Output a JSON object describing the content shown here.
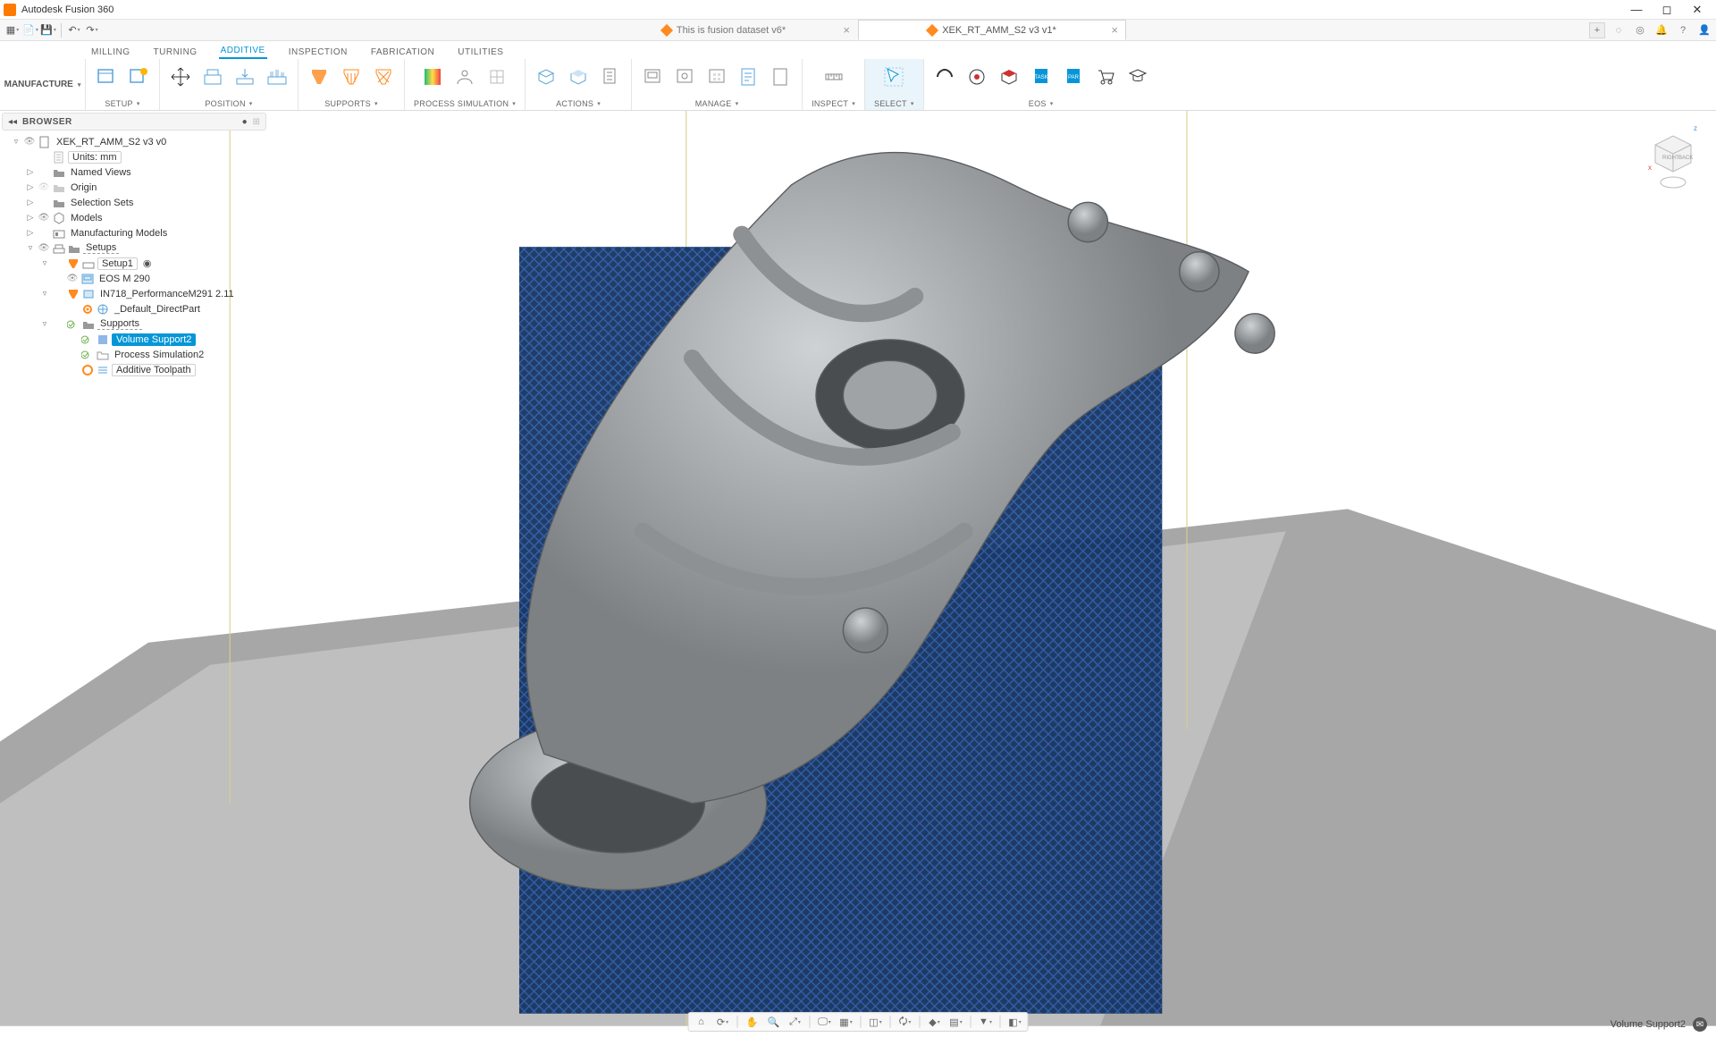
{
  "app": {
    "title": "Autodesk Fusion 360"
  },
  "qat": {
    "items": [
      "grid",
      "file",
      "save",
      "sep",
      "undo",
      "redo"
    ]
  },
  "doc_tabs": [
    {
      "label": "This is fusion dataset v6*",
      "active": false
    },
    {
      "label": "XEK_RT_AMM_S2 v3 v1*",
      "active": true
    }
  ],
  "topright_icons": [
    "plus",
    "globe",
    "target",
    "bell",
    "help",
    "avatar"
  ],
  "ribbon": {
    "workspace": "MANUFACTURE",
    "tabs": [
      "MILLING",
      "TURNING",
      "ADDITIVE",
      "INSPECTION",
      "FABRICATION",
      "UTILITIES"
    ],
    "active_tab": "ADDITIVE",
    "panels": [
      {
        "label": "SETUP",
        "drop": true,
        "icons": [
          "setup",
          "setup2"
        ]
      },
      {
        "label": "POSITION",
        "drop": true,
        "icons": [
          "move",
          "pos1",
          "pos2",
          "pos3"
        ]
      },
      {
        "label": "SUPPORTS",
        "drop": true,
        "icons": [
          "sup1",
          "sup2",
          "sup3"
        ]
      },
      {
        "label": "PROCESS SIMULATION",
        "drop": true,
        "icons": [
          "psim",
          "psim2",
          "psim3"
        ]
      },
      {
        "label": "ACTIONS",
        "drop": true,
        "icons": [
          "act1",
          "act2",
          "act3"
        ]
      },
      {
        "label": "MANAGE",
        "drop": true,
        "icons": [
          "man1",
          "man2",
          "man3",
          "man4",
          "man5"
        ]
      },
      {
        "label": "INSPECT",
        "drop": true,
        "icons": [
          "inspect"
        ]
      },
      {
        "label": "SELECT",
        "drop": true,
        "icons": [
          "select"
        ],
        "highlight": true
      },
      {
        "label": "EOS",
        "drop": true,
        "icons": [
          "eos1",
          "eos2",
          "eos3",
          "eos4",
          "eos5",
          "eos6",
          "eos7"
        ]
      }
    ]
  },
  "browser": {
    "title": "BROWSER",
    "nodes": [
      {
        "depth": 0,
        "tw": "▿",
        "eye": true,
        "icon": "doc",
        "label": "XEK_RT_AMM_S2 v3 v0"
      },
      {
        "depth": 1,
        "tw": "",
        "eye": false,
        "icon": "page",
        "label": "Units: mm",
        "boxed": true
      },
      {
        "depth": 1,
        "tw": "▷",
        "eye": false,
        "icon": "folder",
        "label": "Named Views"
      },
      {
        "depth": 1,
        "tw": "▷",
        "eye": "dim",
        "icon": "folder-dim",
        "label": "Origin"
      },
      {
        "depth": 1,
        "tw": "▷",
        "eye": false,
        "icon": "folder",
        "label": "Selection Sets"
      },
      {
        "depth": 1,
        "tw": "▷",
        "eye": true,
        "icon": "models",
        "label": "Models"
      },
      {
        "depth": 1,
        "tw": "▷",
        "eye": false,
        "icon": "mfg",
        "label": "Manufacturing Models"
      },
      {
        "depth": 1,
        "tw": "▿",
        "eye": true,
        "icon": "setups",
        "label": "Setups",
        "dotted": true
      },
      {
        "depth": 2,
        "tw": "▿",
        "eye": false,
        "icon": "setup-orange",
        "label": "Setup1",
        "boxed": true,
        "radio": true
      },
      {
        "depth": 3,
        "tw": "",
        "eye": true,
        "icon": "machine",
        "label": "EOS M 290"
      },
      {
        "depth": 2,
        "tw": "▿",
        "eye": false,
        "icon": "setup-orange",
        "label": "IN718_PerformanceM291 2.11"
      },
      {
        "depth": 3,
        "tw": "",
        "eye": false,
        "icon": "gear-orange",
        "label": "_Default_DirectPart"
      },
      {
        "depth": 2,
        "tw": "▿",
        "eye": false,
        "icon": "ok-folder",
        "label": "Supports",
        "dotted": true
      },
      {
        "depth": 3,
        "tw": "",
        "eye": false,
        "icon": "ok-vol",
        "label": "Volume Support2",
        "selected": true
      },
      {
        "depth": 3,
        "tw": "",
        "eye": false,
        "icon": "ok-folder2",
        "label": "Process Simulation2"
      },
      {
        "depth": 3,
        "tw": "",
        "eye": false,
        "icon": "add-orange",
        "label": "Additive Toolpath",
        "boxed": true
      }
    ]
  },
  "navbar": [
    "home",
    "orbit",
    "sep",
    "pan",
    "zoom",
    "zoom2",
    "sep",
    "display",
    "grid",
    "sep",
    "section",
    "sep",
    "sync",
    "sep",
    "eye",
    "layers",
    "sep",
    "filter",
    "sep",
    "ruler"
  ],
  "status": {
    "text": "Volume Support2"
  }
}
